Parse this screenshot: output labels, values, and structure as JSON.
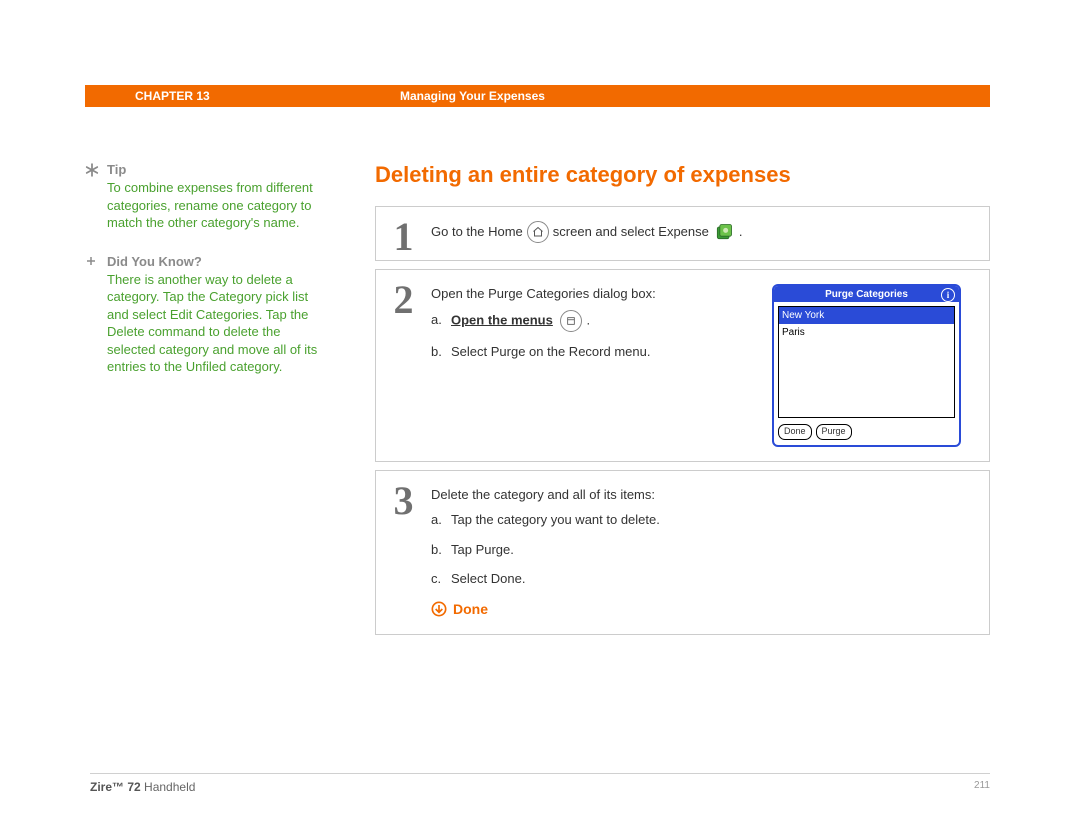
{
  "header": {
    "chapter": "CHAPTER 13",
    "title": "Managing Your Expenses"
  },
  "sidebar": {
    "tip": {
      "heading": "Tip",
      "body": "To combine expenses from different categories, rename one category to match the other category's name."
    },
    "dyk": {
      "heading": "Did You Know?",
      "body": "There is another way to delete a category. Tap the Category pick list and select Edit Categories. Tap the Delete command to delete the selected category and move all of its entries to the Unfiled category."
    }
  },
  "main": {
    "section_title": "Deleting an entire category of expenses",
    "step1": {
      "num": "1",
      "pre": "Go to the Home",
      "mid": "screen and select Expense",
      "post": "."
    },
    "step2": {
      "num": "2",
      "intro": "Open the Purge Categories dialog box:",
      "a_label": "a.",
      "a_bold": "Open the menus",
      "a_post": ".",
      "b_label": "b.",
      "b_text": "Select Purge on the Record menu.",
      "dialog": {
        "title": "Purge Categories",
        "item_selected": "New York",
        "item2": "Paris",
        "btn_done": "Done",
        "btn_purge": "Purge"
      }
    },
    "step3": {
      "num": "3",
      "intro": "Delete the category and all of its items:",
      "a_label": "a.",
      "a_text": "Tap the category you want to delete.",
      "b_label": "b.",
      "b_text": "Tap Purge.",
      "c_label": "c.",
      "c_text": "Select Done.",
      "done": "Done"
    }
  },
  "footer": {
    "product_bold": "Zire™ 72",
    "product_rest": " Handheld",
    "page": "211"
  }
}
